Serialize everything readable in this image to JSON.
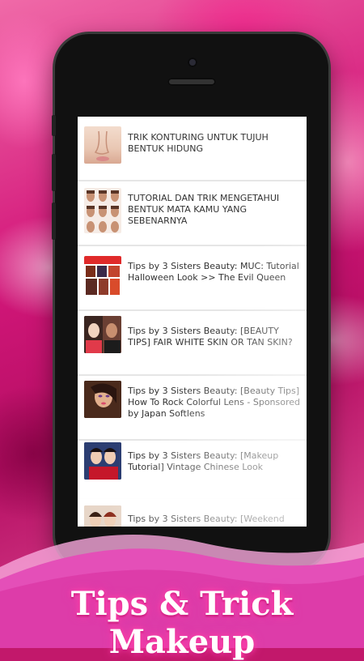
{
  "list": {
    "items": [
      {
        "title": "TRIK KONTURING UNTUK TUJUH BENTUK HIDUNG",
        "thumb": "nose-photo"
      },
      {
        "title": "TUTORIAL DAN TRIK MENGETAHUI BENTUK MATA KAMU YANG SEBENARNYA",
        "thumb": "eye-shapes-photo"
      },
      {
        "title": "Tips by 3 Sisters Beauty: MUC: Tutorial Halloween Look >> The Evil Queen",
        "thumb": "halloween-collage-photo"
      },
      {
        "title": "Tips by 3 Sisters Beauty: [BEAUTY TIPS] FAIR WHITE SKIN OR TAN SKIN?",
        "thumb": "skin-compare-photo"
      },
      {
        "title": "Tips by 3 Sisters Beauty: [Beauty Tips] How To Rock Colorful Lens - Sponsored by Japan Softlens",
        "thumb": "colorful-lens-photo"
      },
      {
        "title": "Tips by 3 Sisters Beauty: [Makeup Tutorial] Vintage Chinese Look",
        "thumb": "vintage-look-photo"
      },
      {
        "title": "Tips by 3 Sisters Beauty: [Weekend",
        "thumb": "weekend-photo"
      }
    ]
  },
  "banner": {
    "title": "Tips & Trick Makeup"
  },
  "colors": {
    "accent_pink": "#e91e8c",
    "banner_pink": "#e44fb8"
  }
}
